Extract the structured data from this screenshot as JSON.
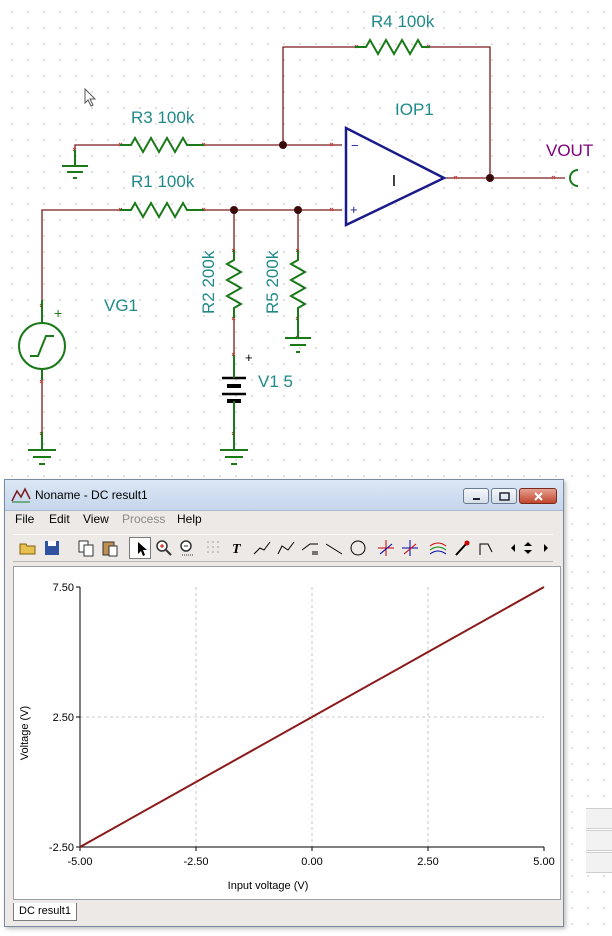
{
  "schematic": {
    "r4": "R4 100k",
    "r3": "R3 100k",
    "r1": "R1 100k",
    "r2": "R2 200k",
    "r5": "R5 200k",
    "vg1": "VG1",
    "v1": "V1 5",
    "iop1": "IOP1",
    "vout": "VOUT",
    "amp_symbol": "I",
    "minus": "−",
    "plus": "+",
    "plus_vg": "+",
    "plus_v1": "+",
    "colors": {
      "wire": "#7a1b1b",
      "resistor": "#1a7a1a",
      "opamp": "#1a1a8a",
      "label": "#1f8a8a",
      "vout": "#800080"
    }
  },
  "window": {
    "title": "Noname - DC result1",
    "menu": {
      "file": "File",
      "edit": "Edit",
      "view": "View",
      "process": "Process",
      "help": "Help"
    },
    "toolbar_icons": [
      "open-icon",
      "save-icon",
      "copy-icon",
      "paste-icon",
      "pointer-icon",
      "zoom-in-icon",
      "zoom-out-icon",
      "grid-icon",
      "text-icon",
      "cursor-a-icon",
      "cursor-b-icon",
      "line-tool-icon",
      "draw-line-icon",
      "circle-icon",
      "cursor-a-red-icon",
      "cursor-b-blue-icon",
      "multi-curve-icon",
      "probe-icon",
      "step-icon",
      "scroll-arrows-icon"
    ],
    "tab": "DC result1"
  },
  "chart_data": {
    "type": "line",
    "title": "",
    "xlabel": "Input voltage (V)",
    "ylabel": "Voltage (V)",
    "xlim": [
      -5,
      5
    ],
    "ylim": [
      -2.5,
      7.5
    ],
    "x_ticks": [
      "-5.00",
      "-2.50",
      "0.00",
      "2.50",
      "5.00"
    ],
    "y_ticks": [
      "-2.50",
      "2.50",
      "7.50"
    ],
    "grid": true,
    "series": [
      {
        "x": [
          -5,
          -2.5,
          0,
          2.5,
          5
        ],
        "values": [
          -2.5,
          0,
          2.5,
          5,
          7.5
        ],
        "color": "#8b1a1a"
      }
    ]
  }
}
